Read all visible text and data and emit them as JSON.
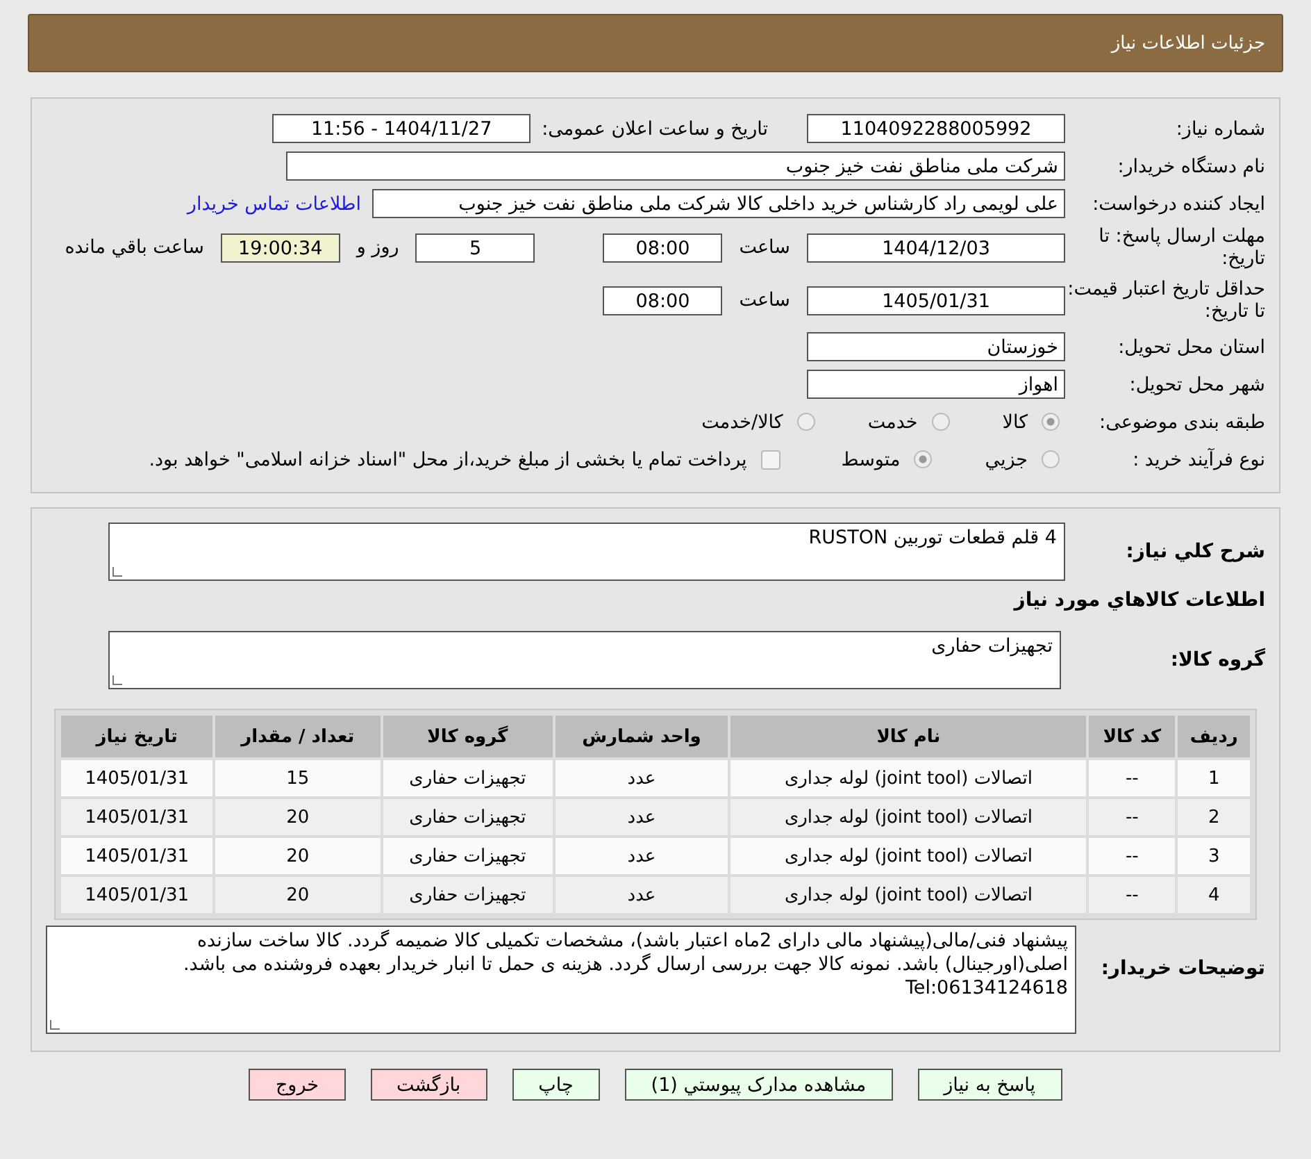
{
  "header": {
    "title": "جزئیات اطلاعات نیاز"
  },
  "need_number": {
    "label": "شماره نیاز:",
    "value": "1104092288005992"
  },
  "announce": {
    "label": "تاریخ و ساعت اعلان عمومی:",
    "value": "1404/11/27 - 11:56"
  },
  "buyer_org": {
    "label": "نام دستگاه خریدار:",
    "value": "شرکت ملی مناطق نفت خیز جنوب"
  },
  "requester": {
    "label": "ایجاد کننده درخواست:",
    "value": "علی  لویمی راد  کارشناس خرید داخلی کالا شرکت ملی مناطق نفت خیز جنوب",
    "link": "اطلاعات تماس خریدار"
  },
  "deadline": {
    "label": "مهلت ارسال پاسخ: تا تاریخ:",
    "date": "1404/12/03",
    "time_label": "ساعت",
    "time": "08:00",
    "days": "5",
    "days_label": "روز و",
    "remaining": "19:00:34",
    "remaining_label": "ساعت باقي مانده"
  },
  "validity": {
    "label": "حداقل تاریخ اعتبار قیمت: تا تاریخ:",
    "date": "1405/01/31",
    "time_label": "ساعت",
    "time": "08:00"
  },
  "province": {
    "label": "استان محل تحویل:",
    "value": "خوزستان"
  },
  "city": {
    "label": "شهر محل تحویل:",
    "value": "اهواز"
  },
  "category": {
    "label": "طبقه بندی موضوعی:",
    "options": [
      {
        "label": "کالا",
        "selected": true
      },
      {
        "label": "خدمت",
        "selected": false
      },
      {
        "label": "کالا/خدمت",
        "selected": false
      }
    ]
  },
  "purchase_type": {
    "label": "نوع فرآیند خرید :",
    "options": [
      {
        "kind": "radio",
        "label": "جزيي",
        "selected": false
      },
      {
        "kind": "radio",
        "label": "متوسط",
        "selected": true
      },
      {
        "kind": "checkbox",
        "label": "پرداخت تمام یا بخشی از مبلغ خرید،از محل \"اسناد خزانه اسلامی\" خواهد بود.",
        "checked": false
      }
    ]
  },
  "summary": {
    "label": "شرح كلي نياز:",
    "value": "4 قلم قطعات توربین RUSTON"
  },
  "goods_heading": "اطلاعات كالاهاي مورد نياز",
  "goods_group": {
    "label": "گروه کالا:",
    "value": "تجهیزات حفاری"
  },
  "table": {
    "columns": [
      "ردیف",
      "کد کالا",
      "نام کالا",
      "واحد شمارش",
      "گروه کالا",
      "تعداد / مقدار",
      "تاریخ نیاز"
    ],
    "rows": [
      [
        "1",
        "--",
        "اتصالات (joint tool) لوله جداری",
        "عدد",
        "تجهیزات حفاری",
        "15",
        "1405/01/31"
      ],
      [
        "2",
        "--",
        "اتصالات (joint tool) لوله جداری",
        "عدد",
        "تجهیزات حفاری",
        "20",
        "1405/01/31"
      ],
      [
        "3",
        "--",
        "اتصالات (joint tool) لوله جداری",
        "عدد",
        "تجهیزات حفاری",
        "20",
        "1405/01/31"
      ],
      [
        "4",
        "--",
        "اتصالات (joint tool) لوله جداری",
        "عدد",
        "تجهیزات حفاری",
        "20",
        "1405/01/31"
      ]
    ]
  },
  "notes": {
    "label": "توضیحات خریدار:",
    "value": "پیشنهاد فنی/مالی(پیشنهاد مالی دارای 2ماه اعتبار باشد)، مشخصات تکمیلی کالا ضمیمه گردد. کالا ساخت سازنده\nاصلی(اورجینال) باشد. نمونه کالا جهت بررسی ارسال گردد. هزینه ی حمل تا انبار خریدار بعهده فروشنده می باشد.\nTel:06134124618"
  },
  "buttons": [
    {
      "label": "پاسخ به نیاز",
      "kind": "action"
    },
    {
      "label": "مشاهده مدارک پیوستي (1)",
      "kind": "action"
    },
    {
      "label": "چاپ",
      "kind": "action"
    },
    {
      "label": "بازگشت",
      "kind": "exit"
    },
    {
      "label": "خروج",
      "kind": "exit"
    }
  ]
}
